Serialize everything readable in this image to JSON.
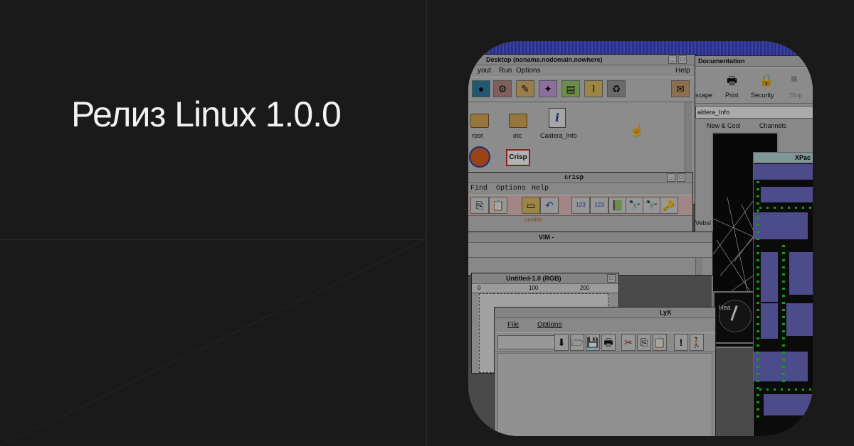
{
  "headline": "Релиз Linux 1.0.0",
  "colors": {
    "background": "#1a1a1a",
    "headline": "#f2f2f2",
    "desktop_blue": "#3a45c8",
    "maze_purple": "#6e6ec8",
    "maze_dot": "#22dd22"
  },
  "desktop_window": {
    "title": "Desktop (noname.nodomain.nowhere)",
    "menu": [
      "yout",
      "Run",
      "Options",
      "Help"
    ],
    "icons": [
      {
        "label": "root",
        "icon": "folder-icon"
      },
      {
        "label": "etc",
        "icon": "folder-icon"
      },
      {
        "label": "Caldera_Info",
        "icon": "info-icon"
      }
    ],
    "glyph_info": "i",
    "crisp_badge": "Crisp"
  },
  "browser_window": {
    "title": "Documentation",
    "buttons": [
      "scape",
      "Print",
      "Security",
      "Stop"
    ],
    "location": "aldera_Info",
    "tabs": [
      "New & Cool",
      "Channels"
    ],
    "side_text": "Vebsi"
  },
  "crisp_window": {
    "title": "crisp",
    "menu": [
      "Find",
      "Options",
      "Help"
    ],
    "file_label": "newfile",
    "tool_label_123": "123"
  },
  "vim_window": {
    "title": "VIM -"
  },
  "gimp_window": {
    "title": "Untitled-1.0 (RGB)",
    "ruler": [
      "0",
      "100",
      "200"
    ]
  },
  "lyx_window": {
    "title": "LyX",
    "menu": [
      "File",
      "Options"
    ]
  },
  "clock_label": "Hea",
  "xpac_window": {
    "title": "XPac"
  }
}
